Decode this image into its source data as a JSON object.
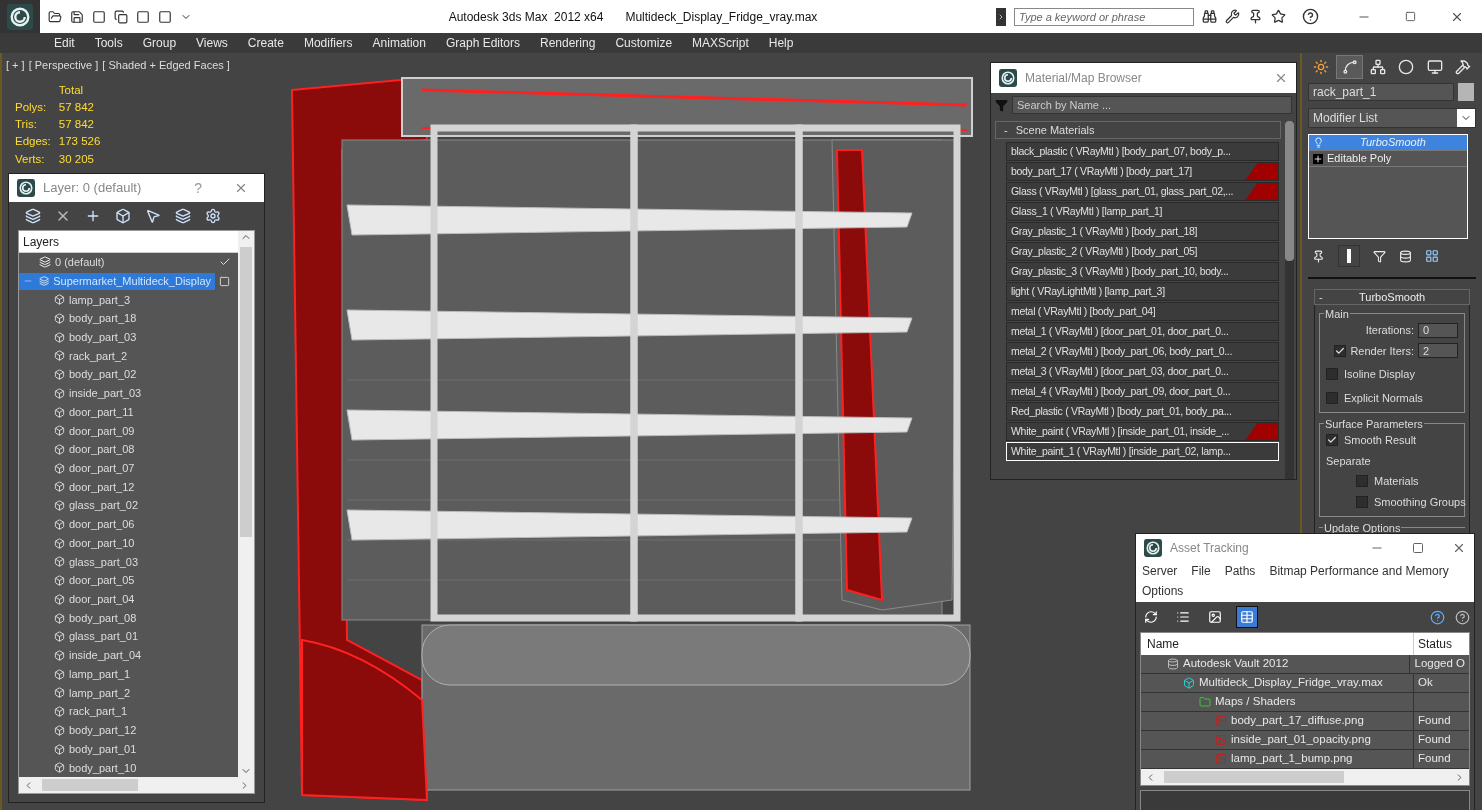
{
  "title_bar": {
    "app": "Autodesk 3ds Max  2012 x64",
    "file": "Multideck_Display_Fridge_vray.max",
    "search": {
      "placeholder": "Type a keyword or phrase"
    }
  },
  "menu": [
    "Edit",
    "Tools",
    "Group",
    "Views",
    "Create",
    "Modifiers",
    "Animation",
    "Graph Editors",
    "Rendering",
    "Customize",
    "MAXScript",
    "Help"
  ],
  "viewport": {
    "labels": [
      "[ + ]",
      "[ Perspective ]",
      "[ Shaded + Edged Faces ]"
    ],
    "stats_heading": "Total",
    "stats": [
      {
        "label": "Polys:",
        "value": "57 842"
      },
      {
        "label": "Tris:",
        "value": "57 842"
      },
      {
        "label": "Edges:",
        "value": "173 526"
      },
      {
        "label": "Verts:",
        "value": "30 205"
      }
    ]
  },
  "layer_window": {
    "title": "Layer: 0 (default)",
    "help": "?",
    "column": "Layers",
    "layers": [
      {
        "name": "0 (default)",
        "selected": false,
        "current": true
      },
      {
        "name": "Supermarket_Multideck_Display",
        "selected": true,
        "current": false,
        "expanded": true,
        "children": [
          "lamp_part_3",
          "body_part_18",
          "body_part_03",
          "rack_part_2",
          "body_part_02",
          "inside_part_03",
          "door_part_11",
          "door_part_09",
          "door_part_08",
          "door_part_07",
          "door_part_12",
          "glass_part_02",
          "door_part_06",
          "door_part_10",
          "glass_part_03",
          "door_part_05",
          "door_part_04",
          "body_part_08",
          "glass_part_01",
          "inside_part_04",
          "lamp_part_1",
          "lamp_part_2",
          "rack_part_1",
          "body_part_12",
          "body_part_01",
          "body_part_10"
        ]
      }
    ]
  },
  "material_browser": {
    "title": "Material/Map Browser",
    "search": {
      "placeholder": "Search by Name ..."
    },
    "group": {
      "toggle": "-",
      "label": "Scene Materials"
    },
    "materials": [
      {
        "label": "black_plastic ( VRayMtl ) [body_part_07, body_p...",
        "flagged": false,
        "selected": false
      },
      {
        "label": "body_part_17 ( VRayMtl ) [body_part_17]",
        "flagged": true,
        "selected": false
      },
      {
        "label": "Glass ( VRayMtl ) [glass_part_01, glass_part_02,...",
        "flagged": true,
        "selected": false
      },
      {
        "label": "Glass_1 ( VRayMtl ) [lamp_part_1]",
        "flagged": false,
        "selected": false
      },
      {
        "label": "Gray_plastic_1 ( VRayMtl ) [body_part_18]",
        "flagged": false,
        "selected": false
      },
      {
        "label": "Gray_plastic_2 ( VRayMtl ) [body_part_05]",
        "flagged": false,
        "selected": false
      },
      {
        "label": "Gray_plastic_3 ( VRayMtl ) [body_part_10, body...",
        "flagged": false,
        "selected": false
      },
      {
        "label": "light ( VRayLightMtl ) [lamp_part_3]",
        "flagged": false,
        "selected": false
      },
      {
        "label": "metal ( VRayMtl ) [body_part_04]",
        "flagged": false,
        "selected": false
      },
      {
        "label": "metal_1 ( VRayMtl ) [door_part_01, door_part_0...",
        "flagged": false,
        "selected": false
      },
      {
        "label": "metal_2 ( VRayMtl ) [body_part_06, body_part_0...",
        "flagged": false,
        "selected": false
      },
      {
        "label": "metal_3 ( VRayMtl ) [door_part_03, door_part_0...",
        "flagged": false,
        "selected": false
      },
      {
        "label": "metal_4 ( VRayMtl ) [body_part_09, door_part_0...",
        "flagged": false,
        "selected": false
      },
      {
        "label": "Red_plastic ( VRayMtl ) [body_part_01, body_pa...",
        "flagged": false,
        "selected": false
      },
      {
        "label": "White_paint ( VRayMtl ) [inside_part_01, inside_...",
        "flagged": true,
        "selected": false
      },
      {
        "label": "White_paint_1 ( VRayMtl ) [inside_part_02, lamp...",
        "flagged": false,
        "selected": true
      }
    ]
  },
  "command_panel": {
    "tabs": [
      {
        "kind": "create",
        "selected": false
      },
      {
        "kind": "modify",
        "selected": true
      },
      {
        "kind": "hierarchy",
        "selected": false
      },
      {
        "kind": "motion",
        "selected": false
      },
      {
        "kind": "display",
        "selected": false
      },
      {
        "kind": "utilities",
        "selected": false
      }
    ],
    "object_name": "rack_part_1",
    "modifier_list": "Modifier List",
    "stack": [
      {
        "name": "TurboSmooth",
        "kind": "modifier",
        "selected": true
      },
      {
        "name": "Editable Poly",
        "kind": "base",
        "selected": false
      }
    ],
    "rollout": {
      "toggle": "-",
      "title": "TurboSmooth",
      "main_title": "Main",
      "iterations": {
        "label": "Iterations:",
        "value": "0"
      },
      "render_iters": {
        "label": "Render Iters:",
        "value": "2",
        "checked": true
      },
      "main_options": [
        {
          "label": "Isoline Display",
          "checked": false
        },
        {
          "label": "Explicit Normals",
          "checked": false
        }
      ],
      "surface_title": "Surface Parameters",
      "smooth_result": {
        "label": "Smooth Result",
        "checked": true
      },
      "separate": "Separate",
      "separate_options": [
        {
          "label": "Materials",
          "checked": false
        },
        {
          "label": "Smoothing Groups",
          "checked": false
        }
      ],
      "update_title": "Update Options"
    }
  },
  "asset_tracking": {
    "title": "Asset Tracking",
    "menu": [
      "Server",
      "File",
      "Paths",
      "Bitmap Performance and Memory",
      "Options"
    ],
    "toolbar": [
      {
        "kind": "refresh",
        "selected": false
      },
      {
        "kind": "list",
        "selected": false
      },
      {
        "kind": "thumbs",
        "selected": false
      },
      {
        "kind": "table",
        "selected": true
      }
    ],
    "columns": [
      "Name",
      "Status"
    ],
    "tree": [
      {
        "name": "Autodesk Vault 2012",
        "status": "Logged O",
        "kind": "vault",
        "children": [
          {
            "name": "Multideck_Display_Fridge_vray.max",
            "status": "Ok",
            "kind": "scene",
            "children": [
              {
                "name": "Maps / Shaders",
                "kind": "folder",
                "children": [
                  {
                    "name": "body_part_17_diffuse.png",
                    "status": "Found",
                    "kind": "image"
                  },
                  {
                    "name": "inside_part_01_opacity.png",
                    "status": "Found",
                    "kind": "image"
                  },
                  {
                    "name": "lamp_part_1_bump.png",
                    "status": "Found",
                    "kind": "image"
                  }
                ]
              }
            ]
          }
        ]
      }
    ]
  }
}
